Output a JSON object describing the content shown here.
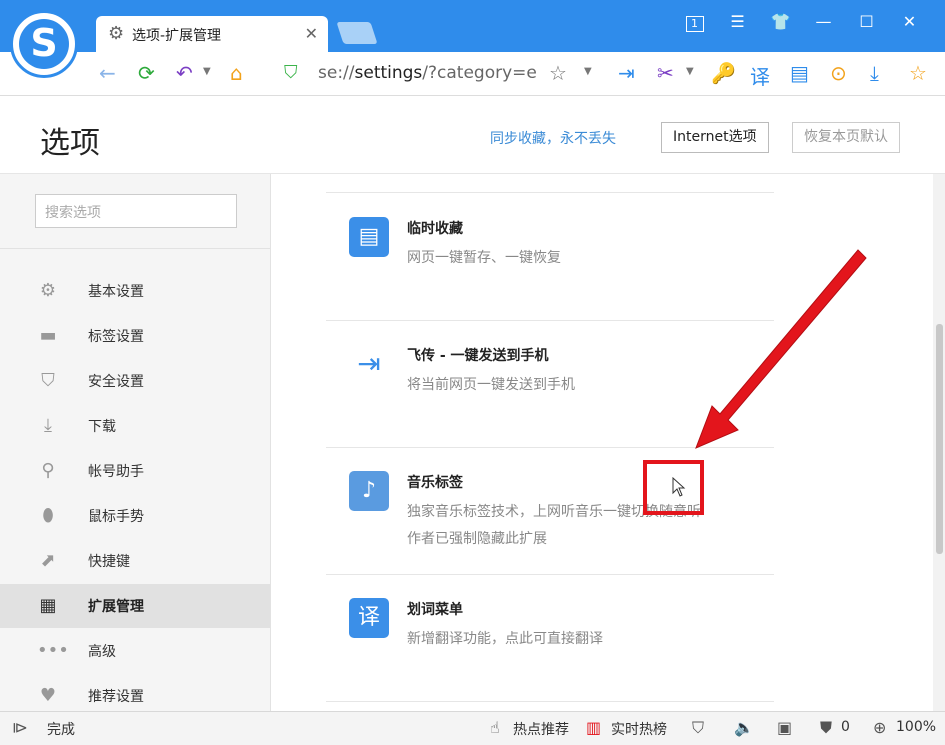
{
  "tab": {
    "title": "选项-扩展管理",
    "icon": "gear-icon",
    "close": "✕"
  },
  "window": {
    "counter": "1"
  },
  "address": {
    "url_prefix": "se://",
    "url_host": "settings",
    "url_rest": "/?category=e"
  },
  "header": {
    "title": "选项",
    "sync_link": "同步收藏，永不丢失",
    "internet_button": "Internet选项",
    "restore_button": "恢复本页默认"
  },
  "sidebar": {
    "search_placeholder": "搜索选项",
    "items": [
      {
        "label": "基本设置",
        "icon": "gear-icon"
      },
      {
        "label": "标签设置",
        "icon": "tab-icon"
      },
      {
        "label": "安全设置",
        "icon": "shield-icon"
      },
      {
        "label": "下载",
        "icon": "download-icon"
      },
      {
        "label": "帐号助手",
        "icon": "key-icon"
      },
      {
        "label": "鼠标手势",
        "icon": "mouse-icon"
      },
      {
        "label": "快捷键",
        "icon": "shortcut-icon"
      },
      {
        "label": "扩展管理",
        "icon": "grid-icon",
        "active": true
      },
      {
        "label": "高级",
        "icon": "more-icon"
      },
      {
        "label": "推荐设置",
        "icon": "heart-icon"
      }
    ]
  },
  "extensions": [
    {
      "name": "临时收藏",
      "desc": "网页一键暂存、一键恢复",
      "icon": "temp-collect-icon",
      "color": "#3b8fe8"
    },
    {
      "name": "飞传 - 一键发送到手机",
      "desc": "将当前网页一键发送到手机",
      "icon": "phone-send-icon",
      "color": "#3b8fe8"
    },
    {
      "name": "音乐标签",
      "desc": "独家音乐标签技术，上网听音乐一键切换随意听",
      "desc2": "作者已强制隐藏此扩展",
      "icon": "music-icon",
      "color": "#5a9be0"
    },
    {
      "name": "划词菜单",
      "desc": "新增翻译功能，点此可直接翻译",
      "icon": "translate-icon",
      "color": "#3b8fe8"
    }
  ],
  "statusbar": {
    "done": "完成",
    "hot_recommend": "热点推荐",
    "realtime_hot": "实时热榜",
    "adblock_count": "0",
    "zoom": "100%"
  },
  "colors": {
    "accent": "#2f8ceb",
    "annotation": "#e3151c"
  }
}
